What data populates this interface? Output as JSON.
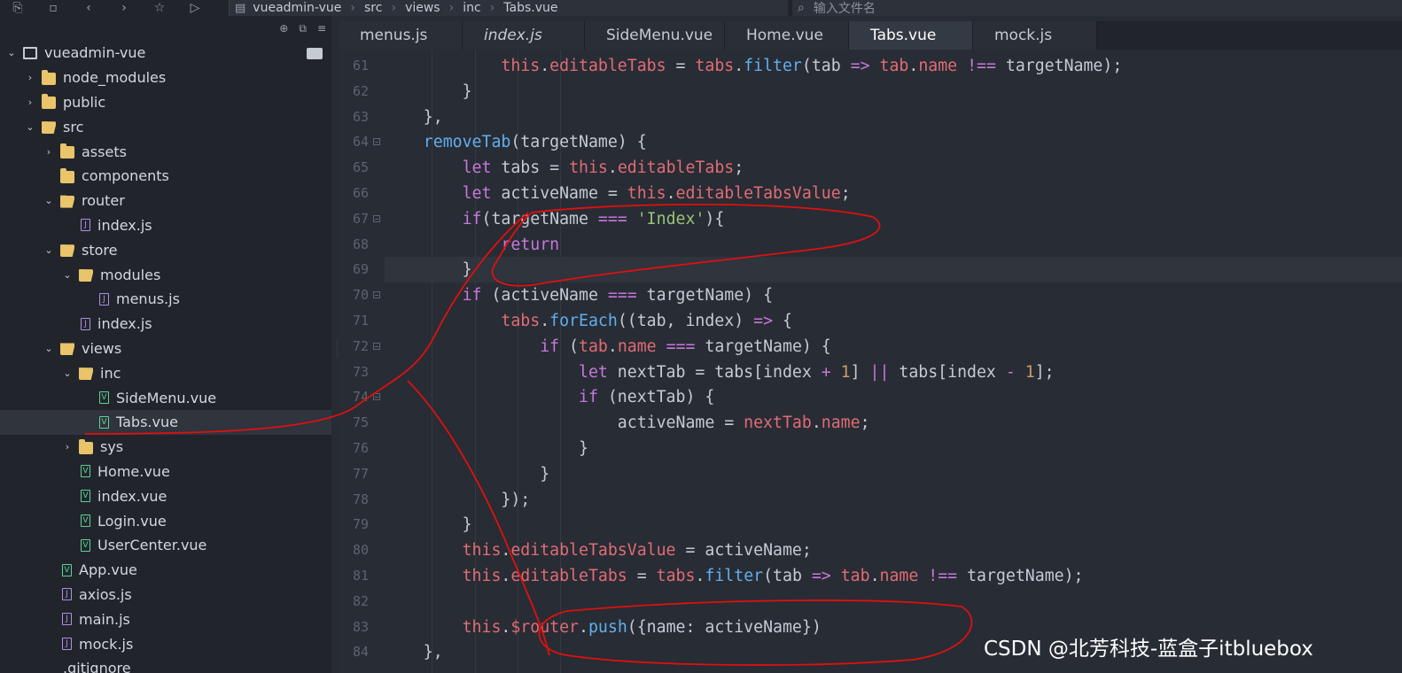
{
  "toolbar": {
    "icons": [
      "new-file-icon",
      "save-icon",
      "back-icon",
      "forward-icon",
      "star-icon",
      "play-icon"
    ],
    "breadcrumb": [
      "vueadmin-vue",
      "src",
      "views",
      "inc",
      "Tabs.vue"
    ],
    "search_placeholder": "输入文件名"
  },
  "sidebar": {
    "tools": [
      "⊕",
      "⧉",
      "≡"
    ],
    "items": [
      {
        "label": "vueadmin-vue",
        "type": "project",
        "depth": 0,
        "expanded": true
      },
      {
        "label": "node_modules",
        "type": "folder",
        "depth": 1,
        "expanded": false
      },
      {
        "label": "public",
        "type": "folder",
        "depth": 1,
        "expanded": false
      },
      {
        "label": "src",
        "type": "folder",
        "depth": 1,
        "expanded": true
      },
      {
        "label": "assets",
        "type": "folder",
        "depth": 2,
        "expanded": false
      },
      {
        "label": "components",
        "type": "folder",
        "depth": 2,
        "noarrow": true
      },
      {
        "label": "router",
        "type": "folder",
        "depth": 2,
        "expanded": true
      },
      {
        "label": "index.js",
        "type": "js",
        "depth": 3
      },
      {
        "label": "store",
        "type": "folder",
        "depth": 2,
        "expanded": true
      },
      {
        "label": "modules",
        "type": "folder",
        "depth": 3,
        "expanded": true
      },
      {
        "label": "menus.js",
        "type": "js",
        "depth": 4
      },
      {
        "label": "index.js",
        "type": "js",
        "depth": 3
      },
      {
        "label": "views",
        "type": "folder",
        "depth": 2,
        "expanded": true
      },
      {
        "label": "inc",
        "type": "folder",
        "depth": 3,
        "expanded": true
      },
      {
        "label": "SideMenu.vue",
        "type": "vue",
        "depth": 4
      },
      {
        "label": "Tabs.vue",
        "type": "vue",
        "depth": 4,
        "selected": true
      },
      {
        "label": "sys",
        "type": "folder",
        "depth": 3,
        "expanded": false
      },
      {
        "label": "Home.vue",
        "type": "vue",
        "depth": 3
      },
      {
        "label": "index.vue",
        "type": "vue",
        "depth": 3
      },
      {
        "label": "Login.vue",
        "type": "vue",
        "depth": 3
      },
      {
        "label": "UserCenter.vue",
        "type": "vue",
        "depth": 3
      },
      {
        "label": "App.vue",
        "type": "vue",
        "depth": 2
      },
      {
        "label": "axios.js",
        "type": "js",
        "depth": 2
      },
      {
        "label": "main.js",
        "type": "js",
        "depth": 2
      },
      {
        "label": "mock.js",
        "type": "js",
        "depth": 2
      },
      {
        "label": ".gitignore",
        "type": "plain",
        "depth": 1
      }
    ]
  },
  "tabs": [
    {
      "label": "menus.js",
      "width": 140
    },
    {
      "label": "index.js",
      "width": 138,
      "italic": true
    },
    {
      "label": "SideMenu.vue",
      "width": 158
    },
    {
      "label": "Home.vue",
      "width": 140
    },
    {
      "label": "Tabs.vue",
      "width": 140,
      "active": true
    },
    {
      "label": "mock.js",
      "width": 140
    }
  ],
  "editor": {
    "lines": [
      {
        "n": "61",
        "code": [
          [
            "t",
            "            this"
          ],
          [
            "p",
            "."
          ],
          [
            "t",
            "editableTabs"
          ],
          [
            "p",
            " = "
          ],
          [
            "t",
            "tabs"
          ],
          [
            "p",
            "."
          ],
          [
            "f",
            "filter"
          ],
          [
            "p",
            "(tab "
          ],
          [
            "k",
            "=>"
          ],
          [
            "p",
            " "
          ],
          [
            "t",
            "tab"
          ],
          [
            "p",
            "."
          ],
          [
            "t",
            "name"
          ],
          [
            "p",
            " "
          ],
          [
            "k",
            "!=="
          ],
          [
            "p",
            " targetName);"
          ]
        ]
      },
      {
        "n": "62",
        "code": [
          [
            "p",
            "        }"
          ]
        ]
      },
      {
        "n": "63",
        "code": [
          [
            "p",
            "    },"
          ]
        ]
      },
      {
        "n": "64",
        "fold": true,
        "code": [
          [
            "f",
            "    removeTab"
          ],
          [
            "p",
            "(targetName) {"
          ]
        ]
      },
      {
        "n": "65",
        "code": [
          [
            "k",
            "        let"
          ],
          [
            "p",
            " tabs = "
          ],
          [
            "t",
            "this"
          ],
          [
            "p",
            "."
          ],
          [
            "t",
            "editableTabs"
          ],
          [
            "p",
            ";"
          ]
        ]
      },
      {
        "n": "66",
        "code": [
          [
            "k",
            "        let"
          ],
          [
            "p",
            " activeName = "
          ],
          [
            "t",
            "this"
          ],
          [
            "p",
            "."
          ],
          [
            "t",
            "editableTabsValue"
          ],
          [
            "p",
            ";"
          ]
        ]
      },
      {
        "n": "67",
        "fold": true,
        "code": [
          [
            "k",
            "        if"
          ],
          [
            "p",
            "(targetName "
          ],
          [
            "k",
            "==="
          ],
          [
            "p",
            " "
          ],
          [
            "s",
            "'Index'"
          ],
          [
            "p",
            "){"
          ]
        ]
      },
      {
        "n": "68",
        "code": [
          [
            "k",
            "            return"
          ]
        ]
      },
      {
        "n": "69",
        "current": true,
        "code": [
          [
            "p",
            "        }"
          ]
        ]
      },
      {
        "n": "70",
        "fold": true,
        "code": [
          [
            "k",
            "        if"
          ],
          [
            "p",
            " (activeName "
          ],
          [
            "k",
            "==="
          ],
          [
            "p",
            " targetName) {"
          ]
        ]
      },
      {
        "n": "71",
        "code": [
          [
            "t",
            "            tabs"
          ],
          [
            "p",
            "."
          ],
          [
            "f",
            "forEach"
          ],
          [
            "p",
            "((tab, index) "
          ],
          [
            "k",
            "=>"
          ],
          [
            "p",
            " {"
          ]
        ]
      },
      {
        "n": "72",
        "fold": true,
        "code": [
          [
            "k",
            "                if"
          ],
          [
            "p",
            " ("
          ],
          [
            "t",
            "tab"
          ],
          [
            "p",
            "."
          ],
          [
            "t",
            "name"
          ],
          [
            "p",
            " "
          ],
          [
            "k",
            "==="
          ],
          [
            "p",
            " targetName) {"
          ]
        ]
      },
      {
        "n": "73",
        "code": [
          [
            "k",
            "                    let"
          ],
          [
            "p",
            " nextTab = tabs[index "
          ],
          [
            "k",
            "+"
          ],
          [
            "p",
            " "
          ],
          [
            "n",
            "1"
          ],
          [
            "p",
            "] "
          ],
          [
            "k",
            "||"
          ],
          [
            "p",
            " tabs[index "
          ],
          [
            "k",
            "-"
          ],
          [
            "p",
            " "
          ],
          [
            "n",
            "1"
          ],
          [
            "p",
            "];"
          ]
        ]
      },
      {
        "n": "74",
        "fold": true,
        "code": [
          [
            "k",
            "                    if"
          ],
          [
            "p",
            " (nextTab) {"
          ]
        ]
      },
      {
        "n": "75",
        "code": [
          [
            "p",
            "                        activeName = "
          ],
          [
            "t",
            "nextTab"
          ],
          [
            "p",
            "."
          ],
          [
            "t",
            "name"
          ],
          [
            "p",
            ";"
          ]
        ]
      },
      {
        "n": "76",
        "code": [
          [
            "p",
            "                    }"
          ]
        ]
      },
      {
        "n": "77",
        "code": [
          [
            "p",
            "                }"
          ]
        ]
      },
      {
        "n": "78",
        "code": [
          [
            "p",
            "            });"
          ]
        ]
      },
      {
        "n": "79",
        "code": [
          [
            "p",
            "        }"
          ]
        ]
      },
      {
        "n": "80",
        "code": [
          [
            "t",
            "        this"
          ],
          [
            "p",
            "."
          ],
          [
            "t",
            "editableTabsValue"
          ],
          [
            "p",
            " = activeName;"
          ]
        ]
      },
      {
        "n": "81",
        "code": [
          [
            "t",
            "        this"
          ],
          [
            "p",
            "."
          ],
          [
            "t",
            "editableTabs"
          ],
          [
            "p",
            " = "
          ],
          [
            "t",
            "tabs"
          ],
          [
            "p",
            "."
          ],
          [
            "f",
            "filter"
          ],
          [
            "p",
            "(tab "
          ],
          [
            "k",
            "=>"
          ],
          [
            "p",
            " "
          ],
          [
            "t",
            "tab"
          ],
          [
            "p",
            "."
          ],
          [
            "t",
            "name"
          ],
          [
            "p",
            " "
          ],
          [
            "k",
            "!=="
          ],
          [
            "p",
            " targetName);"
          ]
        ]
      },
      {
        "n": "82",
        "code": [
          [
            "p",
            ""
          ]
        ]
      },
      {
        "n": "83",
        "code": [
          [
            "t",
            "        this"
          ],
          [
            "p",
            "."
          ],
          [
            "t",
            "$router"
          ],
          [
            "p",
            "."
          ],
          [
            "f",
            "push"
          ],
          [
            "p",
            "({name: activeName})"
          ]
        ]
      },
      {
        "n": "84",
        "code": [
          [
            "p",
            "    },"
          ]
        ]
      }
    ]
  },
  "watermark": "CSDN @北芳科技-蓝盒子itbluebox",
  "colors": {
    "annotation": "#e01010",
    "keyword": "#c678dd",
    "property": "#e06c75",
    "function": "#61afef",
    "string": "#98c379"
  }
}
